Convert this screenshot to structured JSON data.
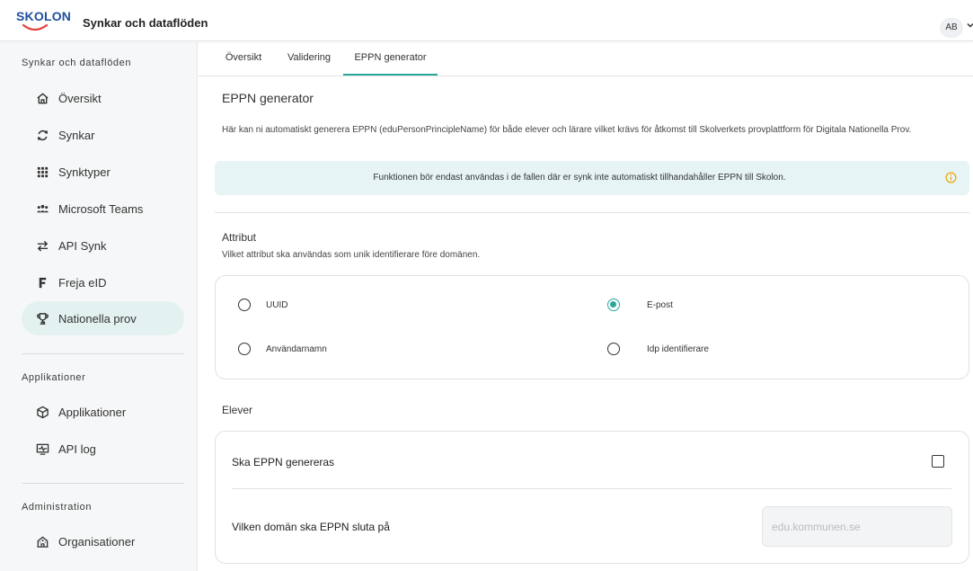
{
  "header": {
    "logo_text": "SKOLON",
    "title": "Synkar och dataflöden",
    "avatar_initials": "AB",
    "brand_color": "#1f4fa0",
    "logo_smile_color": "#e0423a"
  },
  "sidebar": {
    "section1": "Synkar och dataflöden",
    "items1": [
      {
        "label": "Översikt",
        "icon": "home-icon"
      },
      {
        "label": "Synkar",
        "icon": "sync-icon"
      },
      {
        "label": "Synktyper",
        "icon": "grid-icon"
      },
      {
        "label": "Microsoft Teams",
        "icon": "people-icon"
      },
      {
        "label": "API Synk",
        "icon": "swap-arrows-icon"
      },
      {
        "label": "Freja eID",
        "icon": "freja-f-icon"
      },
      {
        "label": "Nationella prov",
        "icon": "trophy-icon",
        "active": true
      }
    ],
    "section2": "Applikationer",
    "items2": [
      {
        "label": "Applikationer",
        "icon": "cube-icon"
      },
      {
        "label": "API log",
        "icon": "activity-monitor-icon"
      }
    ],
    "section3": "Administration",
    "items3": [
      {
        "label": "Organisationer",
        "icon": "school-building-icon"
      }
    ]
  },
  "tabs": [
    {
      "label": "Översikt"
    },
    {
      "label": "Validering"
    },
    {
      "label": "EPPN generator",
      "active": true
    }
  ],
  "main": {
    "title": "EPPN generator",
    "description": "Här kan ni automatiskt generera EPPN (eduPersonPrincipleName) för både elever och lärare vilket krävs för åtkomst till Skolverkets provplattform för Digitala Nationella Prov.",
    "info_text": "Funktionen bör endast användas i de fallen där er synk inte automatiskt tillhandahåller EPPN till Skolon.",
    "attribute": {
      "title": "Attribut",
      "subtitle": "Vilket attribut ska användas som unik identifierare före domänen.",
      "options": [
        {
          "label": "UUID",
          "checked": false
        },
        {
          "label": "E-post",
          "checked": true
        },
        {
          "label": "Användarnamn",
          "checked": false
        },
        {
          "label": "Idp identifierare",
          "checked": false
        }
      ]
    },
    "elever": {
      "title": "Elever",
      "generate_label": "Ska EPPN genereras",
      "generate_checked": false,
      "domain_label": "Vilken domän ska EPPN sluta på",
      "domain_value": "",
      "domain_placeholder": "edu.kommunen.se"
    }
  },
  "colors": {
    "accent": "#2aa79b",
    "info_background": "#e6f4f5",
    "active_nav_background": "#e4f1f1",
    "info_icon": "#f0a400"
  }
}
